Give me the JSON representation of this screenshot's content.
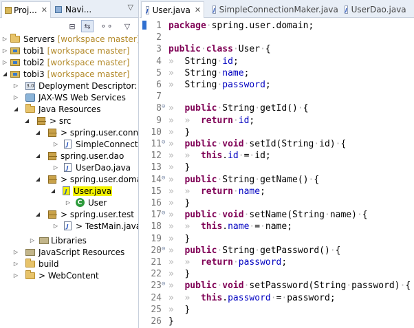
{
  "left_tabs": [
    {
      "label": "Proj...",
      "close": "✕"
    },
    {
      "label": "Navi...",
      "close": ""
    }
  ],
  "panel_menu": "▽",
  "toolbar": {
    "collapse": "⊟",
    "link": "⇆",
    "filter": "⚬⚬",
    "menu": "▽"
  },
  "tree": [
    {
      "label": "Servers",
      "dec": "[workspace master]"
    },
    {
      "label": "tobi1",
      "dec": "[workspace master]"
    },
    {
      "label": "tobi2",
      "dec": "[workspace master]"
    },
    {
      "label": "tobi3",
      "dec": "[workspace master]"
    },
    {
      "label": "Deployment Descriptor: tob",
      "dec": ""
    },
    {
      "label": "JAX-WS Web Services",
      "dec": ""
    },
    {
      "label": "Java Resources",
      "dec": ""
    },
    {
      "label": "> src",
      "dec": ""
    },
    {
      "label": "> spring.user.connec",
      "dec": ""
    },
    {
      "label": "SimpleConnectio",
      "dec": ""
    },
    {
      "label": "spring.user.dao",
      "dec": ""
    },
    {
      "label": "UserDao.java",
      "dec": ""
    },
    {
      "label": "> spring.user.domain",
      "dec": ""
    },
    {
      "label": "User.java",
      "dec": ""
    },
    {
      "label": "User",
      "dec": ""
    },
    {
      "label": "> spring.user.test",
      "dec": ""
    },
    {
      "label": "> TestMain.java",
      "dec": ""
    },
    {
      "label": "Libraries",
      "dec": ""
    },
    {
      "label": "JavaScript Resources",
      "dec": ""
    },
    {
      "label": "build",
      "dec": ""
    },
    {
      "label": "> WebContent",
      "dec": ""
    }
  ],
  "editor_tabs": [
    {
      "label": "User.java",
      "close": "✕"
    },
    {
      "label": "SimpleConnectionMaker.java",
      "close": ""
    },
    {
      "label": "UserDao.java",
      "close": ""
    }
  ],
  "code": [
    {
      "n": "1",
      "fold": "",
      "t": [
        [
          "kw",
          "package"
        ],
        [
          "",
          "·spring.user.domain;"
        ]
      ]
    },
    {
      "n": "2",
      "fold": "",
      "t": []
    },
    {
      "n": "3",
      "fold": "",
      "t": [
        [
          "kw",
          "public"
        ],
        [
          "",
          "·"
        ],
        [
          "kw",
          "class"
        ],
        [
          "",
          "·User·{"
        ]
      ]
    },
    {
      "n": "4",
      "fold": "",
      "t": [
        [
          "ws",
          "»  "
        ],
        [
          "",
          "String·"
        ],
        [
          "fld",
          "id"
        ],
        [
          "",
          ";"
        ]
      ]
    },
    {
      "n": "5",
      "fold": "",
      "t": [
        [
          "ws",
          "»  "
        ],
        [
          "",
          "String·"
        ],
        [
          "fld",
          "name"
        ],
        [
          "",
          ";"
        ]
      ]
    },
    {
      "n": "6",
      "fold": "",
      "t": [
        [
          "ws",
          "»  "
        ],
        [
          "",
          "String·"
        ],
        [
          "fld",
          "password"
        ],
        [
          "",
          ";"
        ]
      ]
    },
    {
      "n": "7",
      "fold": "",
      "t": []
    },
    {
      "n": "8",
      "fold": "⊖",
      "t": [
        [
          "ws",
          "»  "
        ],
        [
          "kw",
          "public"
        ],
        [
          "",
          "·String·getId()·{"
        ]
      ]
    },
    {
      "n": "9",
      "fold": "",
      "t": [
        [
          "ws",
          "»  »  "
        ],
        [
          "kw",
          "return"
        ],
        [
          "",
          "·"
        ],
        [
          "fld",
          "id"
        ],
        [
          "",
          ";"
        ]
      ]
    },
    {
      "n": "10",
      "fold": "",
      "t": [
        [
          "ws",
          "»  "
        ],
        [
          "",
          "}"
        ]
      ]
    },
    {
      "n": "11",
      "fold": "⊖",
      "t": [
        [
          "ws",
          "»  "
        ],
        [
          "kw",
          "public"
        ],
        [
          "",
          "·"
        ],
        [
          "kw",
          "void"
        ],
        [
          "",
          "·setId(String·id)·{"
        ]
      ]
    },
    {
      "n": "12",
      "fold": "",
      "t": [
        [
          "ws",
          "»  »  "
        ],
        [
          "kw",
          "this"
        ],
        [
          "",
          "."
        ],
        [
          "fld",
          "id"
        ],
        [
          "",
          "·=·id;"
        ]
      ]
    },
    {
      "n": "13",
      "fold": "",
      "t": [
        [
          "ws",
          "»  "
        ],
        [
          "",
          "}"
        ]
      ]
    },
    {
      "n": "14",
      "fold": "⊖",
      "t": [
        [
          "ws",
          "»  "
        ],
        [
          "kw",
          "public"
        ],
        [
          "",
          "·String·getName()·{"
        ]
      ]
    },
    {
      "n": "15",
      "fold": "",
      "t": [
        [
          "ws",
          "»  »  "
        ],
        [
          "kw",
          "return"
        ],
        [
          "",
          "·"
        ],
        [
          "fld",
          "name"
        ],
        [
          "",
          ";"
        ]
      ]
    },
    {
      "n": "16",
      "fold": "",
      "t": [
        [
          "ws",
          "»  "
        ],
        [
          "",
          "}"
        ]
      ]
    },
    {
      "n": "17",
      "fold": "⊖",
      "t": [
        [
          "ws",
          "»  "
        ],
        [
          "kw",
          "public"
        ],
        [
          "",
          "·"
        ],
        [
          "kw",
          "void"
        ],
        [
          "",
          "·setName(String·name)·{"
        ]
      ]
    },
    {
      "n": "18",
      "fold": "",
      "t": [
        [
          "ws",
          "»  »  "
        ],
        [
          "kw",
          "this"
        ],
        [
          "",
          "."
        ],
        [
          "fld",
          "name"
        ],
        [
          "",
          "·=·name;"
        ]
      ]
    },
    {
      "n": "19",
      "fold": "",
      "t": [
        [
          "ws",
          "»  "
        ],
        [
          "",
          "}"
        ]
      ]
    },
    {
      "n": "20",
      "fold": "⊖",
      "t": [
        [
          "ws",
          "»  "
        ],
        [
          "kw",
          "public"
        ],
        [
          "",
          "·String·getPassword()·{"
        ]
      ]
    },
    {
      "n": "21",
      "fold": "",
      "t": [
        [
          "ws",
          "»  »  "
        ],
        [
          "kw",
          "return"
        ],
        [
          "",
          "·"
        ],
        [
          "fld",
          "password"
        ],
        [
          "",
          ";"
        ]
      ]
    },
    {
      "n": "22",
      "fold": "",
      "t": [
        [
          "ws",
          "»  "
        ],
        [
          "",
          "}"
        ]
      ]
    },
    {
      "n": "23",
      "fold": "⊖",
      "t": [
        [
          "ws",
          "»  "
        ],
        [
          "kw",
          "public"
        ],
        [
          "",
          "·"
        ],
        [
          "kw",
          "void"
        ],
        [
          "",
          "·setPassword(String·password)·{"
        ]
      ]
    },
    {
      "n": "24",
      "fold": "",
      "t": [
        [
          "ws",
          "»  »  "
        ],
        [
          "kw",
          "this"
        ],
        [
          "",
          "."
        ],
        [
          "fld",
          "password"
        ],
        [
          "",
          "·=·password;"
        ]
      ]
    },
    {
      "n": "25",
      "fold": "",
      "t": [
        [
          "ws",
          "»  "
        ],
        [
          "",
          "}"
        ]
      ]
    },
    {
      "n": "26",
      "fold": "",
      "t": [
        [
          "",
          "}"
        ]
      ]
    }
  ]
}
